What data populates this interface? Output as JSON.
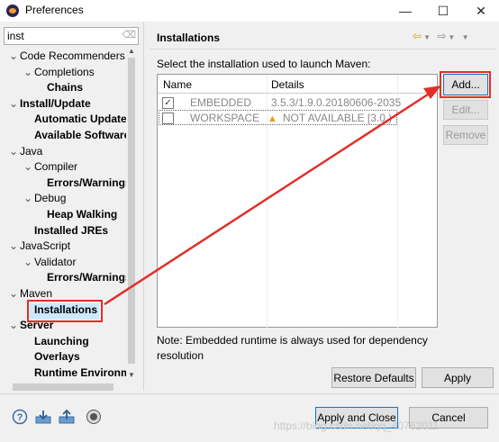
{
  "window": {
    "title": "Preferences",
    "controls": [
      "—",
      "☐",
      "✕"
    ]
  },
  "filter": {
    "value": "inst"
  },
  "tree": [
    {
      "label": "Code Recommenders",
      "level": 0,
      "twisty": "v",
      "bold": false
    },
    {
      "label": "Completions",
      "level": 1,
      "twisty": "v",
      "bold": false
    },
    {
      "label": "Chains",
      "level": 2,
      "twisty": "",
      "bold": true
    },
    {
      "label": "Install/Update",
      "level": 0,
      "twisty": "v",
      "bold": true
    },
    {
      "label": "Automatic Update",
      "level": 1,
      "twisty": "",
      "bold": true
    },
    {
      "label": "Available Software",
      "level": 1,
      "twisty": "",
      "bold": true
    },
    {
      "label": "Java",
      "level": 0,
      "twisty": "v",
      "bold": false
    },
    {
      "label": "Compiler",
      "level": 1,
      "twisty": "v",
      "bold": false
    },
    {
      "label": "Errors/Warnings",
      "level": 2,
      "twisty": "",
      "bold": true
    },
    {
      "label": "Debug",
      "level": 1,
      "twisty": "v",
      "bold": false
    },
    {
      "label": "Heap Walking",
      "level": 2,
      "twisty": "",
      "bold": true
    },
    {
      "label": "Installed JREs",
      "level": 1,
      "twisty": "",
      "bold": true
    },
    {
      "label": "JavaScript",
      "level": 0,
      "twisty": "v",
      "bold": false
    },
    {
      "label": "Validator",
      "level": 1,
      "twisty": "v",
      "bold": false
    },
    {
      "label": "Errors/Warnings",
      "level": 2,
      "twisty": "",
      "bold": true
    },
    {
      "label": "Maven",
      "level": 0,
      "twisty": "v",
      "bold": false
    },
    {
      "label": "Installations",
      "level": 1,
      "twisty": "",
      "bold": true,
      "selected": true
    },
    {
      "label": "Server",
      "level": 0,
      "twisty": "v",
      "bold": true
    },
    {
      "label": "Launching",
      "level": 1,
      "twisty": "",
      "bold": true
    },
    {
      "label": "Overlays",
      "level": 1,
      "twisty": "",
      "bold": true
    },
    {
      "label": "Runtime Environments",
      "level": 1,
      "twisty": "",
      "bold": true
    }
  ],
  "panel": {
    "title": "Installations",
    "instruction": "Select the installation used to launch Maven:",
    "table": {
      "headers": [
        "Name",
        "Details"
      ],
      "rows": [
        {
          "checked": true,
          "name": "EMBEDDED",
          "details": "3.5.3/1.9.0.20180606-2035",
          "warning": false
        },
        {
          "checked": false,
          "name": "WORKSPACE",
          "details": "NOT AVAILABLE [3.0,)",
          "warning": true
        }
      ]
    },
    "buttons": {
      "add": "Add...",
      "edit": "Edit...",
      "remove": "Remove"
    },
    "note": "Note: Embedded runtime is always used for dependency resolution",
    "restore_defaults": "Restore Defaults",
    "apply": "Apply"
  },
  "footer": {
    "icons": [
      "help-icon",
      "import-icon",
      "export-icon",
      "record-icon"
    ],
    "apply_and_close": "Apply and Close",
    "cancel": "Cancel",
    "watermark": "https://blog.csdn.net/qq_40762011"
  },
  "annotation_color": "#e0302a"
}
